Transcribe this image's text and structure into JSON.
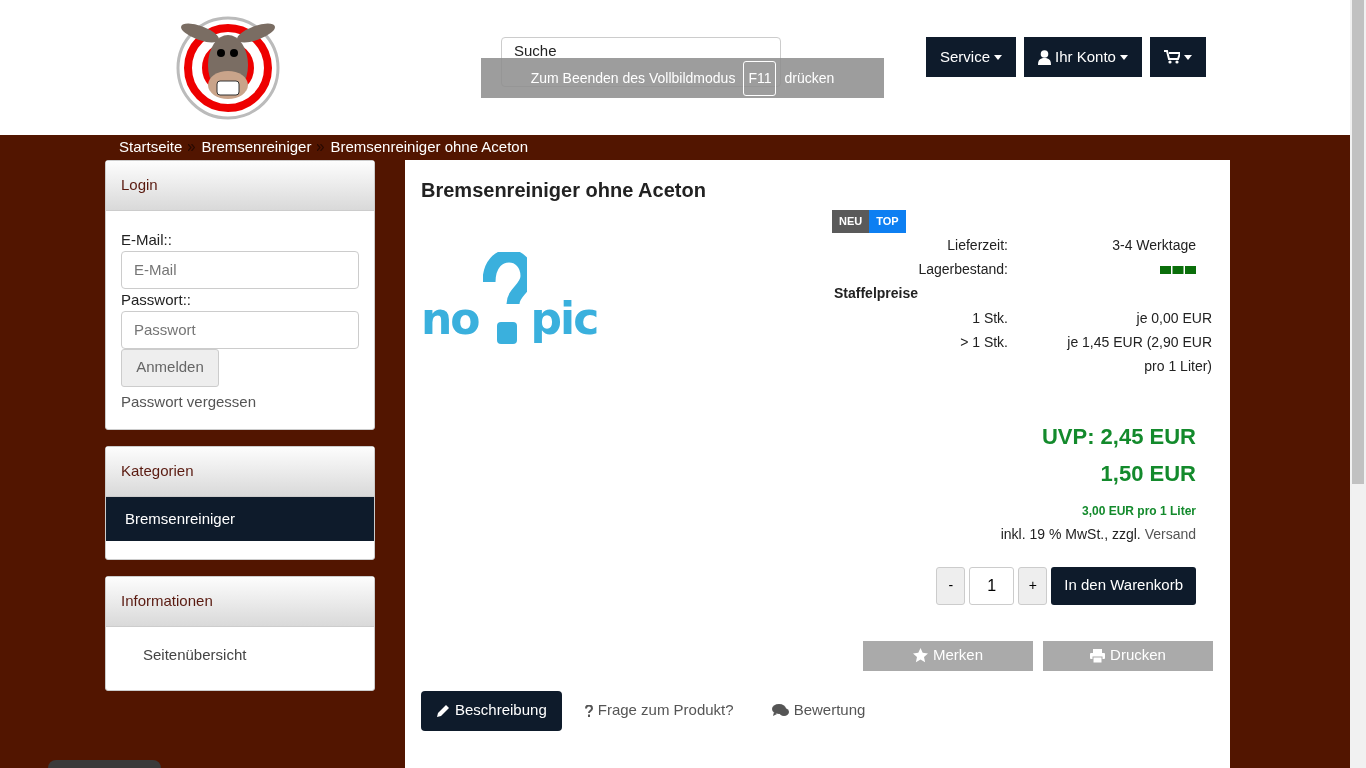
{
  "header": {
    "search": {
      "placeholder": "Suche"
    },
    "fullscreen_notice": {
      "before": "Zum Beenden des Vollbildmodus",
      "key": "F11",
      "after": "drücken"
    },
    "buttons": [
      {
        "label": "Service",
        "kind": "dropdown"
      },
      {
        "label": "Ihr Konto",
        "kind": "account"
      },
      {
        "kind": "cart"
      }
    ]
  },
  "breadcrumb": [
    "Startseite",
    "Bremsenreiniger",
    "Bremsenreiniger ohne Aceton"
  ],
  "login": {
    "title": "Login",
    "email_label": "E-Mail::",
    "email_placeholder": "E-Mail",
    "password_label": "Passwort::",
    "password_placeholder": "Passwort",
    "submit": "Anmelden",
    "forgot": "Passwort vergessen"
  },
  "categories": {
    "title": "Kategorien",
    "items": [
      {
        "label": "Bremsenreiniger",
        "selected": true
      }
    ]
  },
  "information": {
    "title": "Informationen",
    "items": [
      "Seitenübersicht"
    ]
  },
  "product": {
    "title": "Bremsenreiniger ohne Aceton",
    "image_text": [
      "no",
      "pic"
    ],
    "badges": [
      {
        "label": "NEU",
        "color": "#5a5a5a"
      },
      {
        "label": "TOP",
        "color": "#0d7ff2"
      }
    ],
    "details": [
      {
        "label": "Lieferzeit:",
        "value": "3-4 Werktage",
        "kind": "text"
      },
      {
        "label": "Lagerbestand:",
        "kind": "stock"
      }
    ],
    "tier_title": "Staffelpreise",
    "tiers": [
      {
        "qty": "1 Stk.",
        "price": "je 0,00 EUR"
      },
      {
        "qty": "> 1 Stk.",
        "price": "je 1,45 EUR (2,90 EUR pro 1 Liter)"
      }
    ],
    "rrp": "UVP: 2,45 EUR",
    "price": "1,50 EUR",
    "unit_price": "3,00 EUR pro 1 Liter",
    "tax_text": "inkl. 19 % MwSt., zzgl.",
    "shipping_link": "Versand",
    "quantity": {
      "minus": "-",
      "value": "1",
      "plus": "+"
    },
    "add_to_cart": "In den Warenkorb",
    "actions": [
      {
        "label": "Merken",
        "kind": "star"
      },
      {
        "label": "Drucken",
        "kind": "print"
      }
    ],
    "tabs": [
      {
        "label": "Beschreibung",
        "kind": "pencil",
        "selected": true
      },
      {
        "label": "Frage zum Produkt?",
        "kind": "question",
        "selected": false
      },
      {
        "label": "Bewertung",
        "kind": "comments",
        "selected": false
      }
    ]
  }
}
